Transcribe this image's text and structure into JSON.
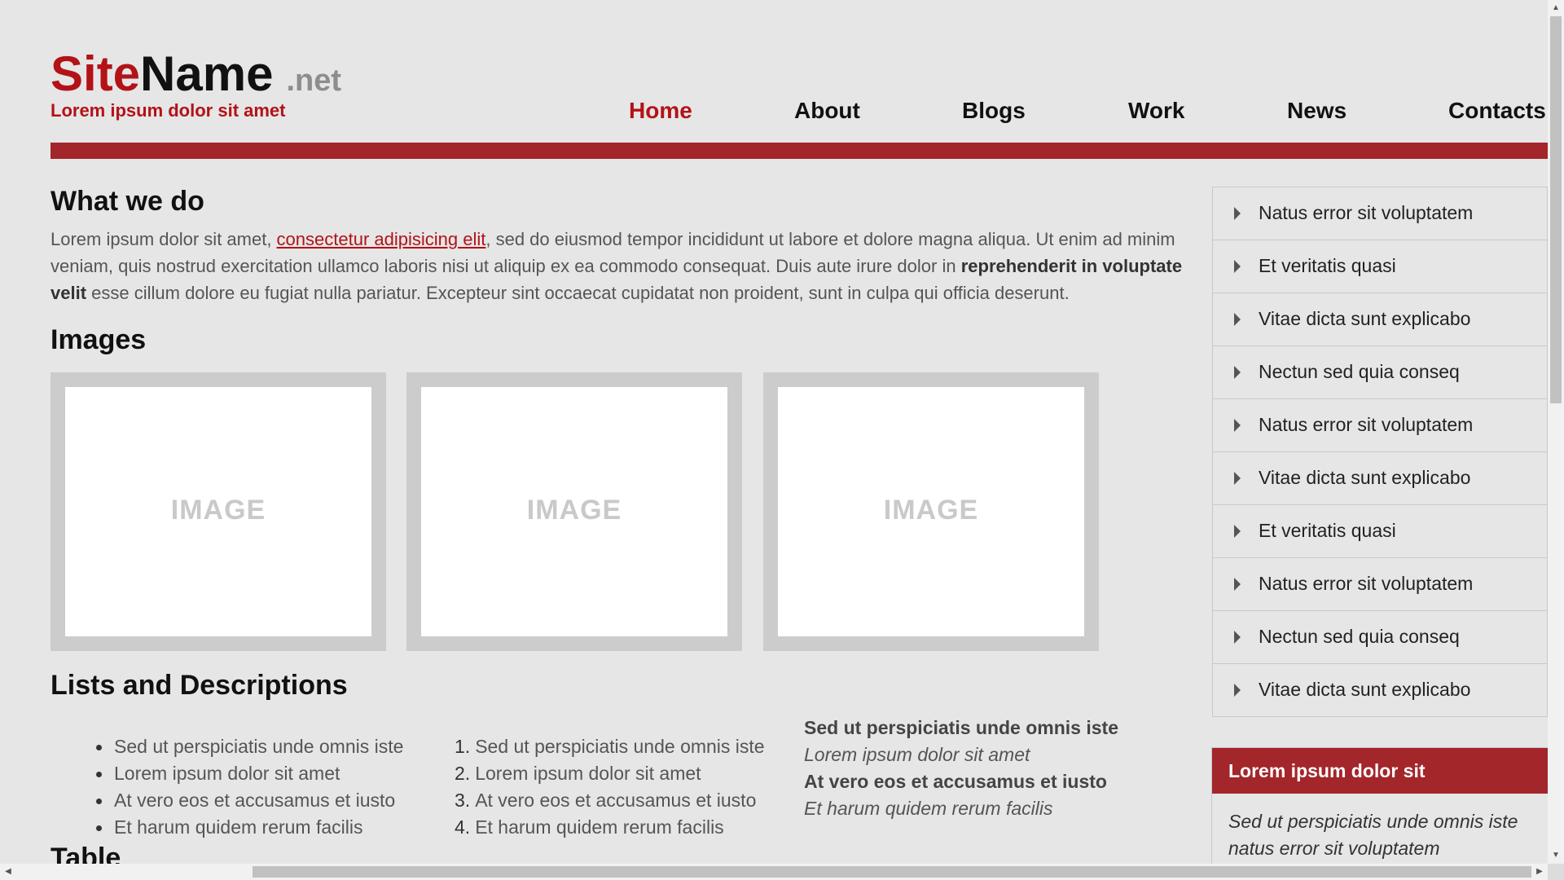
{
  "header": {
    "logo_part1": "Site",
    "logo_part2": "Name",
    "logo_suffix": ".net",
    "tagline": "Lorem ipsum dolor sit amet"
  },
  "nav": {
    "items": [
      "Home",
      "About",
      "Blogs",
      "Work",
      "News",
      "Contacts"
    ],
    "active": "Home"
  },
  "main": {
    "what_we_do_title": "What we do",
    "intro": {
      "t1": "Lorem ipsum dolor sit amet, ",
      "link": "consectetur adipisicing elit",
      "t2": ", sed do eiusmod tempor incididunt ut labore et dolore magna aliqua. Ut enim ad minim veniam, quis nostrud exercitation ullamco laboris nisi ut aliquip ex ea commodo consequat. Duis aute irure dolor in ",
      "bold": "reprehenderit in voluptate velit",
      "t3": " esse cillum dolore eu fugiat nulla pariatur. Excepteur sint occaecat cupidatat non proident, sunt in culpa qui officia deserunt."
    },
    "images_title": "Images",
    "images": [
      "IMAGE",
      "IMAGE",
      "IMAGE"
    ],
    "lists_title": "Lists and Descriptions",
    "ul": [
      "Sed ut perspiciatis unde omnis iste",
      "Lorem ipsum dolor sit amet",
      "At vero eos et accusamus et iusto",
      "Et harum quidem rerum facilis"
    ],
    "ol": [
      "Sed ut perspiciatis unde omnis iste",
      "Lorem ipsum dolor sit amet",
      "At vero eos et accusamus et iusto",
      "Et harum quidem rerum facilis"
    ],
    "ol_numbers": [
      "1.",
      "2.",
      "3.",
      "4."
    ],
    "dl": [
      "Sed ut perspiciatis unde omnis iste",
      "Lorem ipsum dolor sit amet",
      "At vero eos et accusamus et iusto",
      "Et harum quidem rerum facilis"
    ],
    "table_title": "Table"
  },
  "sidebar": {
    "items": [
      "Natus error sit voluptatem",
      "Et veritatis quasi",
      "Vitae dicta sunt explicabo",
      "Nectun sed quia conseq",
      "Natus error sit voluptatem",
      "Vitae dicta sunt explicabo",
      "Et veritatis quasi",
      "Natus error sit voluptatem",
      "Nectun sed quia conseq",
      "Vitae dicta sunt explicabo"
    ],
    "box_title": "Lorem ipsum dolor sit",
    "box_text": "Sed ut perspiciatis unde omnis iste natus error sit voluptatem"
  },
  "colors": {
    "accent": "#a3262a",
    "brand_red": "#b31217",
    "background": "#e6e6e6"
  }
}
